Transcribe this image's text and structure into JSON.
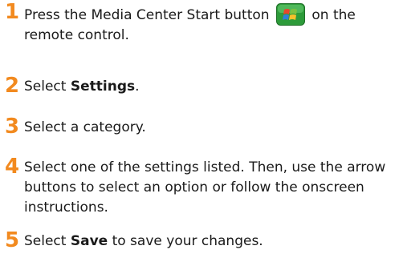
{
  "colors": {
    "step_number": "#f28a1f",
    "icon_bg": "#2d9b3a"
  },
  "steps": [
    {
      "number": "1",
      "text_before": "Press the Media Center Start button",
      "icon": "windows-start-button-icon",
      "text_after": "on the remote control."
    },
    {
      "number": "2",
      "text_before": "Select ",
      "bold": "Settings",
      "text_after": "."
    },
    {
      "number": "3",
      "text": "Select a category."
    },
    {
      "number": "4",
      "text": "Select one of the settings listed. Then, use the arrow buttons to select an option or follow the onscreen instructions."
    },
    {
      "number": "5",
      "text_before": "Select ",
      "bold": "Save",
      "text_after": " to save your changes."
    }
  ]
}
